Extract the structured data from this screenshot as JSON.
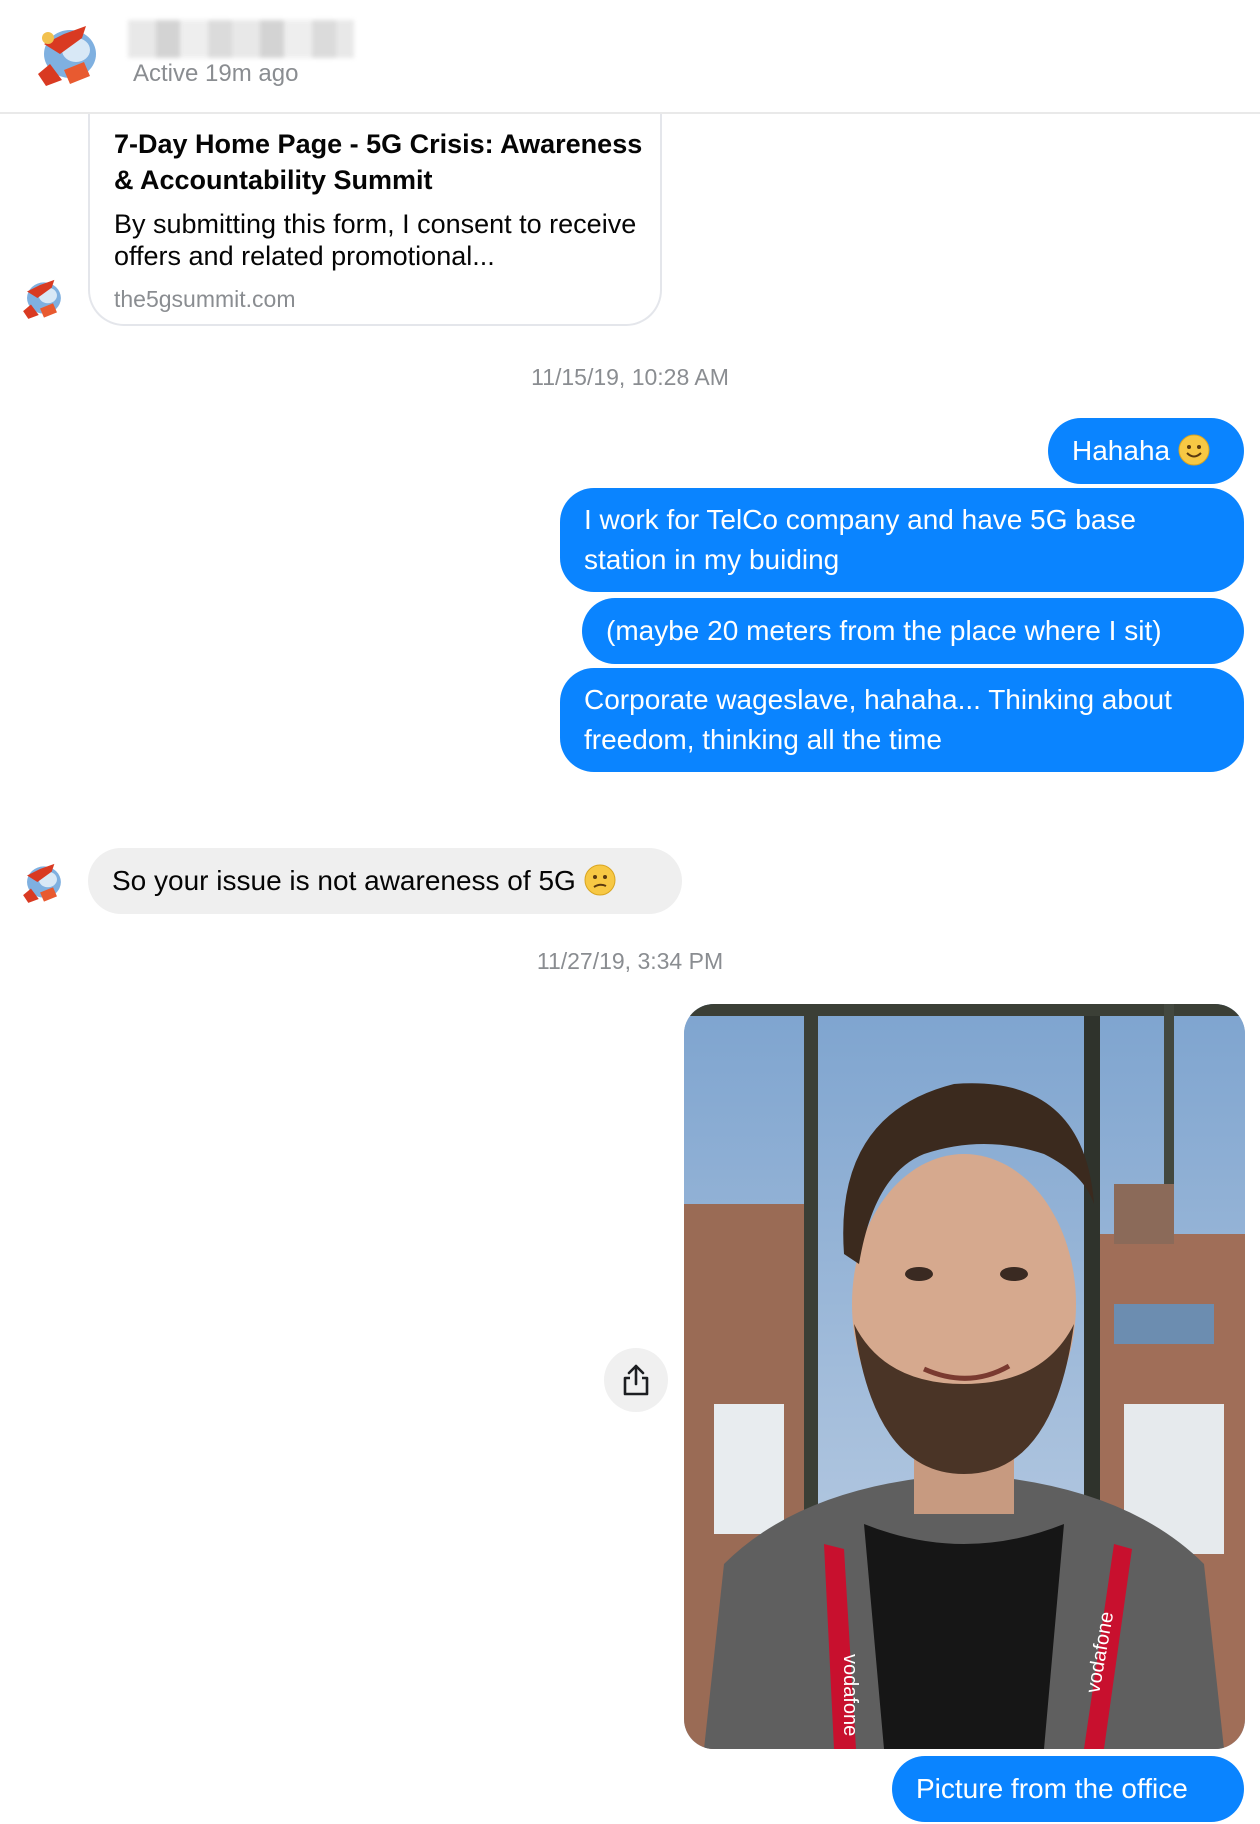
{
  "header": {
    "active_status": "Active 19m ago"
  },
  "link_preview": {
    "title": "7-Day Home Page - 5G Crisis: Awareness & Accountability Summit",
    "description": "By submitting this form, I consent to receive offers and related promotional...",
    "domain": "the5gsummit.com"
  },
  "timestamps": [
    "11/15/19, 10:28 AM",
    "11/27/19, 3:34 PM"
  ],
  "messages_outgoing_1": [
    "Hahaha",
    "I work for TelCo company and have 5G base station in my buiding",
    "(maybe 20 meters from the place where I sit)",
    "Corporate wageslave, hahaha... Thinking about freedom, thinking all the time"
  ],
  "message_incoming": "So your issue is not awareness of 5G",
  "photo_message": {
    "lanyard_text": "vodafone"
  },
  "message_outgoing_last": "Picture from the office",
  "colors": {
    "outgoing_bubble": "#0a84ff",
    "incoming_bubble": "#efefef",
    "meta_text": "#8a8d91"
  }
}
